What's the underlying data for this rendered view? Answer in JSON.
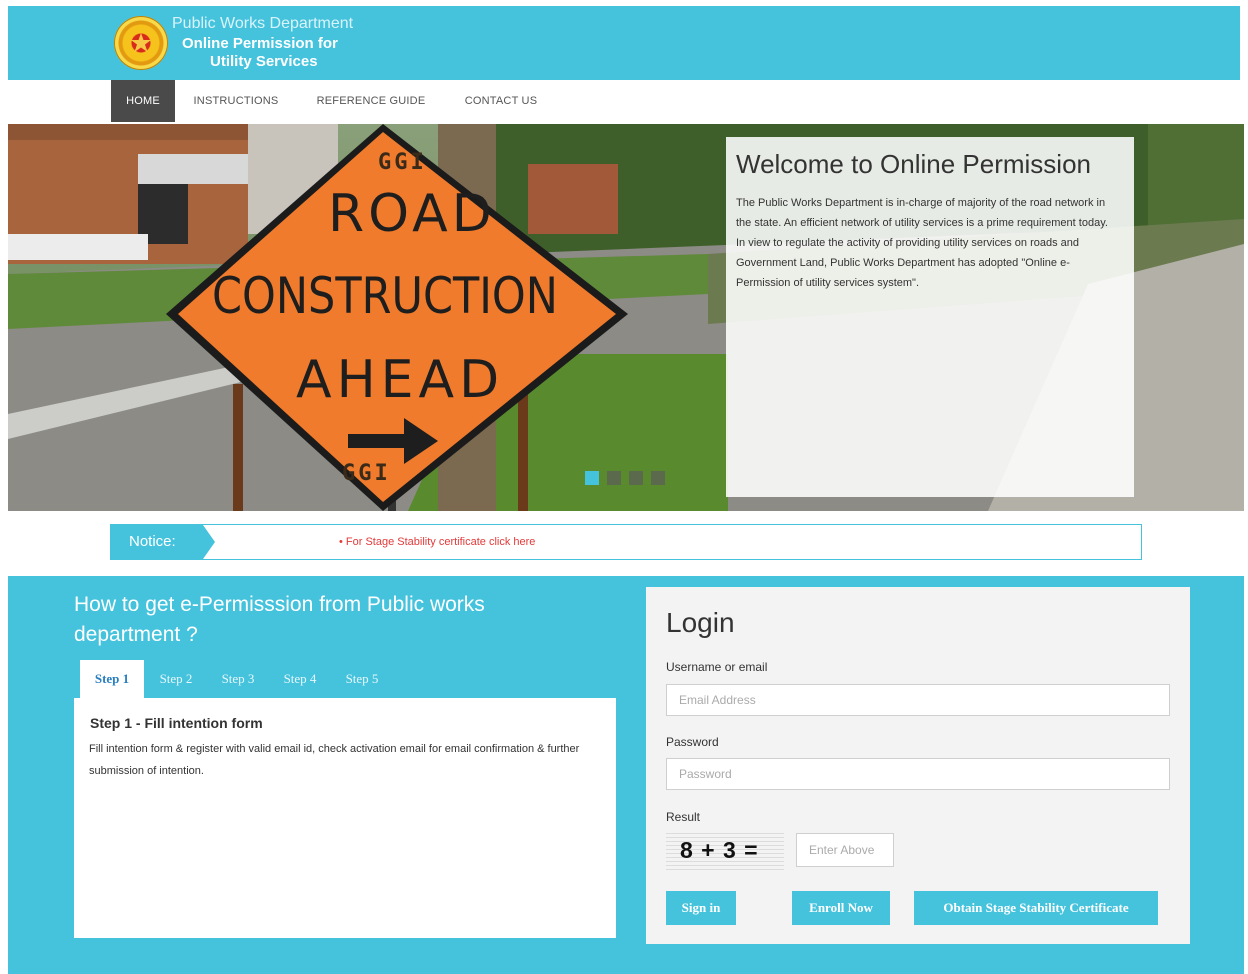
{
  "header": {
    "line1": "Public Works Department",
    "line2": "Online Permission for",
    "line3": "Utility Services",
    "emblem": "state-emblem"
  },
  "nav": {
    "items": [
      {
        "label": "HOME",
        "active": true
      },
      {
        "label": "INSTRUCTIONS",
        "active": false
      },
      {
        "label": "REFERENCE GUIDE",
        "active": false
      },
      {
        "label": "CONTACT US",
        "active": false
      }
    ]
  },
  "hero": {
    "sign": {
      "code_top": "GGI",
      "line1": "ROAD",
      "line2": "CONSTRUCTION",
      "line3": "AHEAD",
      "code_bottom": "GGI"
    },
    "welcome_title": "Welcome to Online Permission",
    "welcome_text": "The Public Works Department is in-charge of majority of the road network in the state. An efficient network of utility services is a prime requirement today. In view to regulate the activity of providing utility services on roads and Government Land, Public Works Department has adopted \"Online e-Permission of utility services system\".",
    "slide_count": 4,
    "active_slide": 1
  },
  "notice": {
    "label": "Notice:",
    "link": "• For Stage Stability certificate click here"
  },
  "how": {
    "title": "How to get e-Permisssion from Public works department ?",
    "tabs": [
      "Step 1",
      "Step 2",
      "Step 3",
      "Step 4",
      "Step 5"
    ],
    "active_tab": 0,
    "step_title": "Step 1 - Fill intention form",
    "step_desc": "Fill intention form & register with valid email id, check activation email for email confirmation & further submission of intention."
  },
  "login": {
    "title": "Login",
    "username_label": "Username or email",
    "username_placeholder": "Email Address",
    "password_label": "Password",
    "password_placeholder": "Password",
    "result_label": "Result",
    "captcha": "8 + 3 =",
    "captcha_placeholder": "Enter Above",
    "signin": "Sign in",
    "enroll": "Enroll Now",
    "certificate": "Obtain Stage Stability Certificate"
  },
  "colors": {
    "accent": "#45c3dd",
    "nav_active": "#4a4a4a",
    "notice_link": "#e23a3a",
    "sign_orange": "#f07b2c"
  }
}
